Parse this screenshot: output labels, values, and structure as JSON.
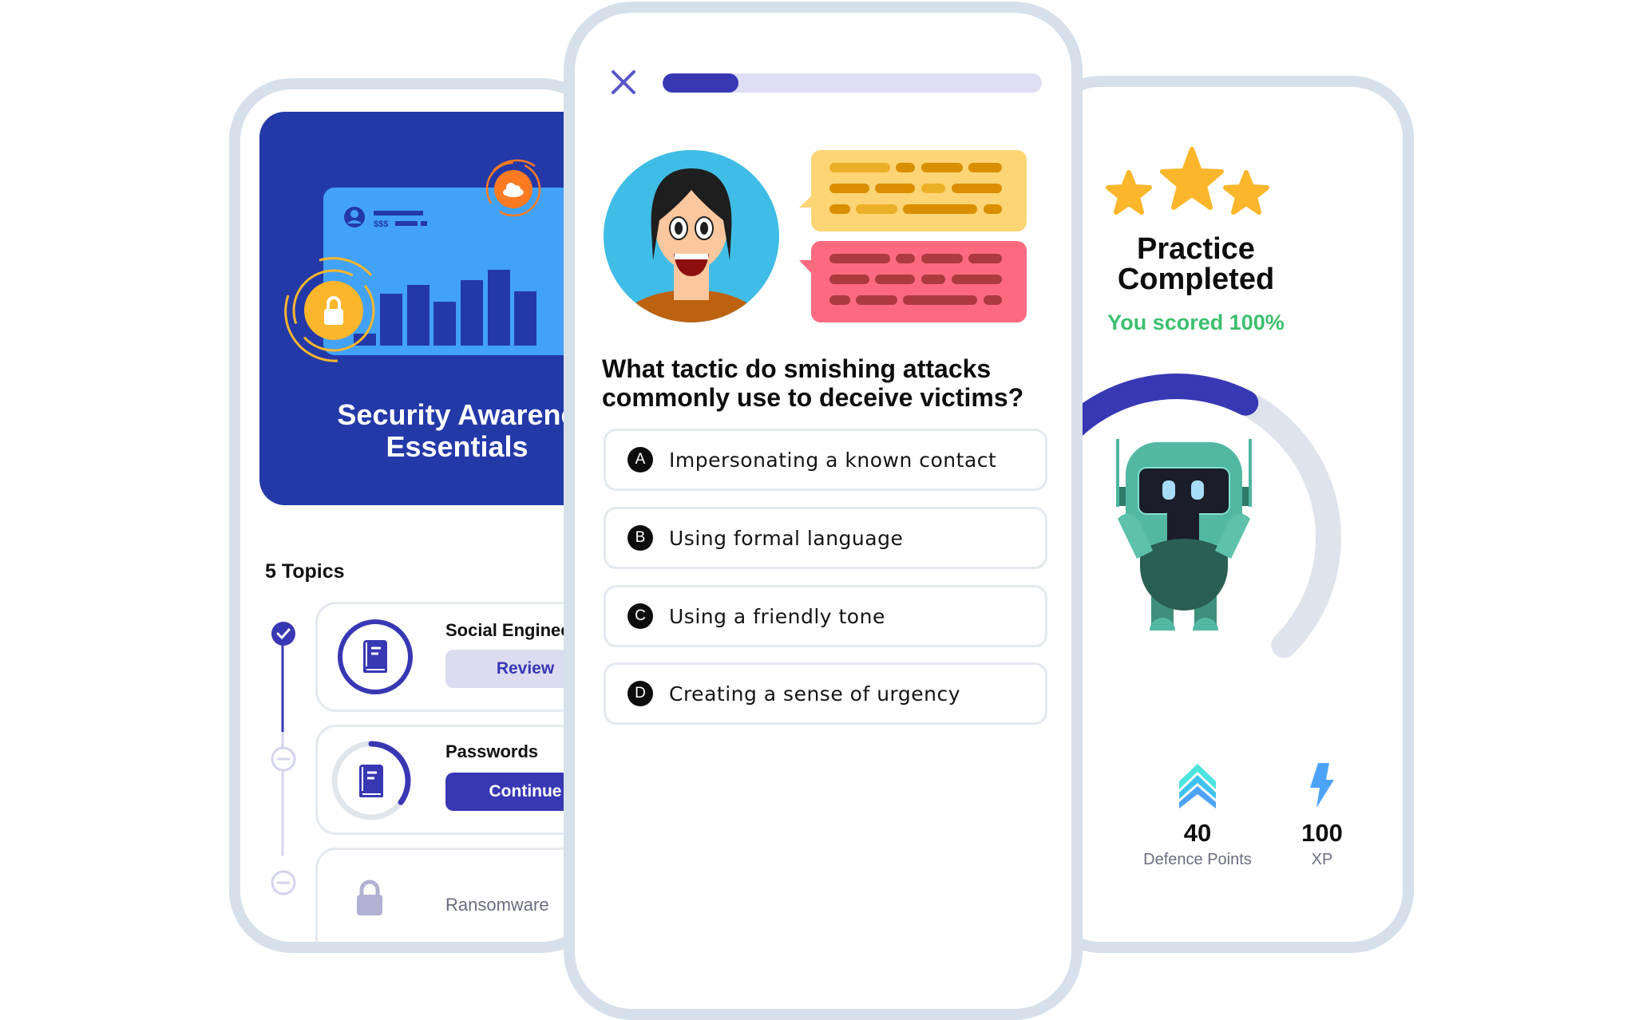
{
  "left_screen": {
    "course_title_line1": "Security Awarene",
    "course_title_line2": "Essentials",
    "hero_card": {
      "label": "$$$"
    },
    "topics_heading": "5 Topics",
    "topics": [
      {
        "name": "Social Enginee",
        "status": "completed",
        "button": "Review"
      },
      {
        "name": "Passwords",
        "status": "in-progress",
        "progress": 0.35,
        "button": "Continue"
      },
      {
        "name": "Ransomware",
        "status": "locked"
      }
    ]
  },
  "quiz_screen": {
    "progress": 0.2,
    "question": "What tactic do smishing attacks commonly use to deceive victims?",
    "options": [
      {
        "letter": "A",
        "text": "Impersonating a known contact"
      },
      {
        "letter": "B",
        "text": "Using formal language"
      },
      {
        "letter": "C",
        "text": "Using a friendly tone"
      },
      {
        "letter": "D",
        "text": "Creating a sense of urgency"
      }
    ]
  },
  "result_screen": {
    "stars": 3,
    "title_line1": "Practice",
    "title_line2": "Completed",
    "score_text": "You scored 100%",
    "level_progress": 0.6,
    "stats": [
      {
        "icon": "chevrons-up-icon",
        "value": "40",
        "label": "Defence Points"
      },
      {
        "icon": "lightning-icon",
        "value": "100",
        "label": "XP"
      }
    ]
  },
  "colors": {
    "primary": "#3838b4",
    "hero_bg": "#2439a8",
    "success": "#3cbf6f",
    "star": "#fbb62c",
    "phone_frame": "#d6e0ea"
  }
}
